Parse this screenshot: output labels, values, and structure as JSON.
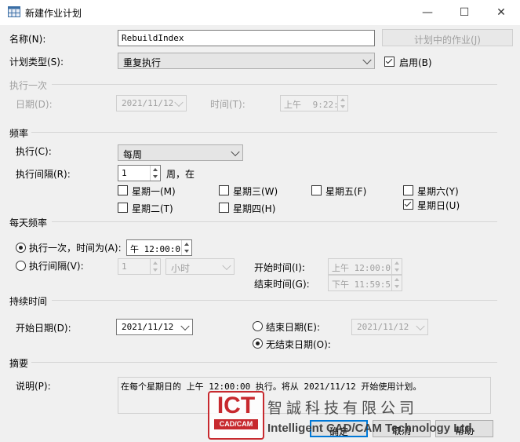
{
  "window": {
    "title": "新建作业计划",
    "minimize": "—",
    "maximize": "☐",
    "close": "✕"
  },
  "name": {
    "label": "名称(N):",
    "value": "RebuildIndex",
    "jobs_in_schedule_button": "计划中的作业(J)"
  },
  "schedule_type": {
    "label": "计划类型(S):",
    "value": "重复执行",
    "enabled_label": "启用(B)",
    "enabled": true
  },
  "one_time": {
    "section": "执行一次",
    "date_label": "日期(D):",
    "date_value": "2021/11/12",
    "time_label": "时间(T):",
    "time_ampm": "上午",
    "time_value": "9:22:"
  },
  "frequency": {
    "section": "频率",
    "occurs_label": "执行(C):",
    "occurs_value": "每周",
    "recurs_label": "执行间隔(R):",
    "recurs_value": "1",
    "recurs_suffix": "周，在",
    "days": [
      {
        "label": "星期一(M)",
        "checked": false
      },
      {
        "label": "星期三(W)",
        "checked": false
      },
      {
        "label": "星期五(F)",
        "checked": false
      },
      {
        "label": "星期六(Y)",
        "checked": false
      },
      {
        "label": "星期二(T)",
        "checked": false
      },
      {
        "label": "星期四(H)",
        "checked": false
      },
      {
        "label": "星期日(U)",
        "checked": true
      }
    ]
  },
  "daily": {
    "section": "每天频率",
    "once_label": "执行一次，时间为(A):",
    "once_value": "午 12:00:0",
    "every_label": "执行间隔(V):",
    "every_value": "1",
    "every_unit": "小时",
    "start_label": "开始时间(I):",
    "start_value": "上午 12:00:0",
    "end_label": "结束时间(G):",
    "end_value": "下午 11:59:5"
  },
  "duration": {
    "section": "持续时间",
    "start_label": "开始日期(D):",
    "start_value": "2021/11/12",
    "end_label": "结束日期(E):",
    "end_value": "2021/11/12",
    "no_end_label": "无结束日期(O):"
  },
  "summary": {
    "section": "摘要",
    "desc_label": "说明(P):",
    "desc_value": "在每个星期日的 上午 12:00:00 执行。将从 2021/11/12 开始使用计划。"
  },
  "buttons": {
    "ok": "确定",
    "cancel": "取消",
    "help": "帮助"
  },
  "watermark": {
    "logo_big": "ICT",
    "logo_small": "CAD/CAM",
    "company_cn": "智誠科技有限公司",
    "company_en": "Intelligent CAD/CAM Technology Ltd."
  },
  "colors": {
    "accent": "#0078d7",
    "watermark_red": "#c7292e"
  }
}
